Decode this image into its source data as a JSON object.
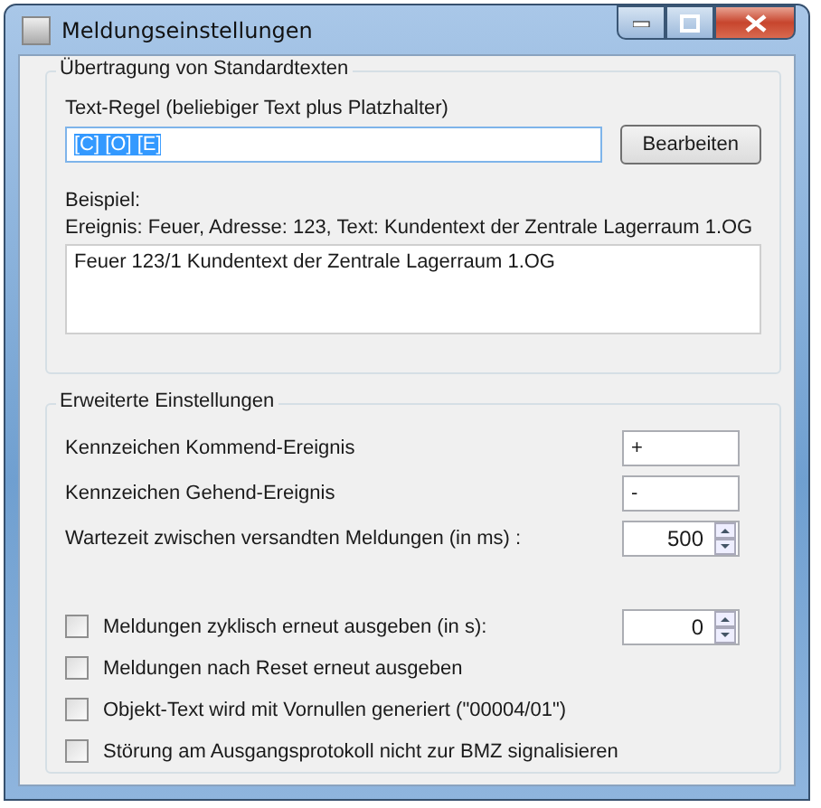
{
  "window": {
    "title": "Meldungseinstellungen"
  },
  "standard_texts": {
    "title": "Übertragung von Standardtexten",
    "rule_label": "Text-Regel (beliebiger Text plus Platzhalter)",
    "rule_value": "[C] [O] [E]",
    "rule_selected": true,
    "edit_button": "Bearbeiten",
    "example_label": "Beispiel:",
    "example_input": "Ereignis: Feuer, Adresse: 123, Text: Kundentext der Zentrale Lagerraum 1.OG",
    "example_output": "Feuer 123/1 Kundentext der Zentrale Lagerraum 1.OG"
  },
  "advanced": {
    "title": "Erweiterte Einstellungen",
    "fields": [
      {
        "kind": "text",
        "label": "Kennzeichen Kommend-Ereignis",
        "value": "+"
      },
      {
        "kind": "text",
        "label": "Kennzeichen Gehend-Ereignis",
        "value": "-"
      },
      {
        "kind": "spin",
        "label": "Wartezeit zwischen versandten Meldungen (in ms) :",
        "value": "500"
      }
    ],
    "options": [
      {
        "label": "Meldungen zyklisch erneut ausgeben (in s):",
        "checked": false,
        "spin_value": "0"
      },
      {
        "label": "Meldungen nach Reset erneut ausgeben",
        "checked": false
      },
      {
        "label": "Objekt-Text wird mit Vornullen generiert (\"00004/01\")",
        "checked": false
      },
      {
        "label": "Störung am Ausgangsprotokoll nicht zur BMZ signalisieren",
        "checked": false
      }
    ]
  }
}
